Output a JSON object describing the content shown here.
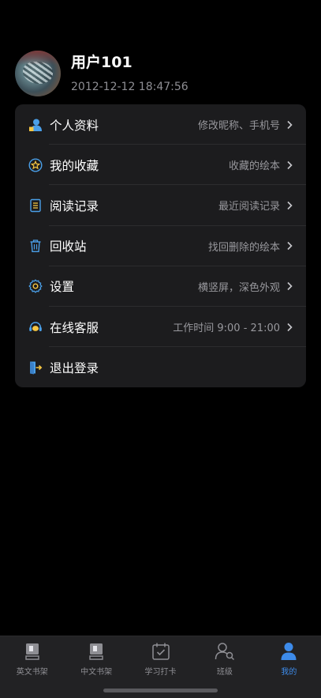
{
  "profile": {
    "username": "用户101",
    "timestamp": "2012-12-12 18:47:56"
  },
  "menu": {
    "items": [
      {
        "label": "个人资料",
        "sub": "修改昵称、手机号",
        "icon": "profile-icon",
        "has_chevron": true
      },
      {
        "label": "我的收藏",
        "sub": "收藏的绘本",
        "icon": "star-icon",
        "has_chevron": true
      },
      {
        "label": "阅读记录",
        "sub": "最近阅读记录",
        "icon": "document-icon",
        "has_chevron": true
      },
      {
        "label": "回收站",
        "sub": "找回删除的绘本",
        "icon": "trash-icon",
        "has_chevron": true
      },
      {
        "label": "设置",
        "sub": "横竖屏，深色外观",
        "icon": "gear-icon",
        "has_chevron": true
      },
      {
        "label": "在线客服",
        "sub": "工作时间 9:00 - 21:00",
        "icon": "headset-icon",
        "has_chevron": true
      },
      {
        "label": "退出登录",
        "sub": "",
        "icon": "logout-icon",
        "has_chevron": false
      }
    ]
  },
  "tabbar": {
    "tabs": [
      {
        "label": "英文书架",
        "icon": "book-icon",
        "active": false
      },
      {
        "label": "中文书架",
        "icon": "book-icon",
        "active": false
      },
      {
        "label": "学习打卡",
        "icon": "calendar-check-icon",
        "active": false
      },
      {
        "label": "班级",
        "icon": "class-users-icon",
        "active": false
      },
      {
        "label": "我的",
        "icon": "person-icon",
        "active": true
      }
    ]
  },
  "colors": {
    "background": "#000000",
    "card": "#1c1c1e",
    "icon_blue": "#4a9fe8",
    "icon_yellow": "#f5c542",
    "active_tab": "#3d8bea",
    "inactive_tab": "#8e8e93"
  }
}
